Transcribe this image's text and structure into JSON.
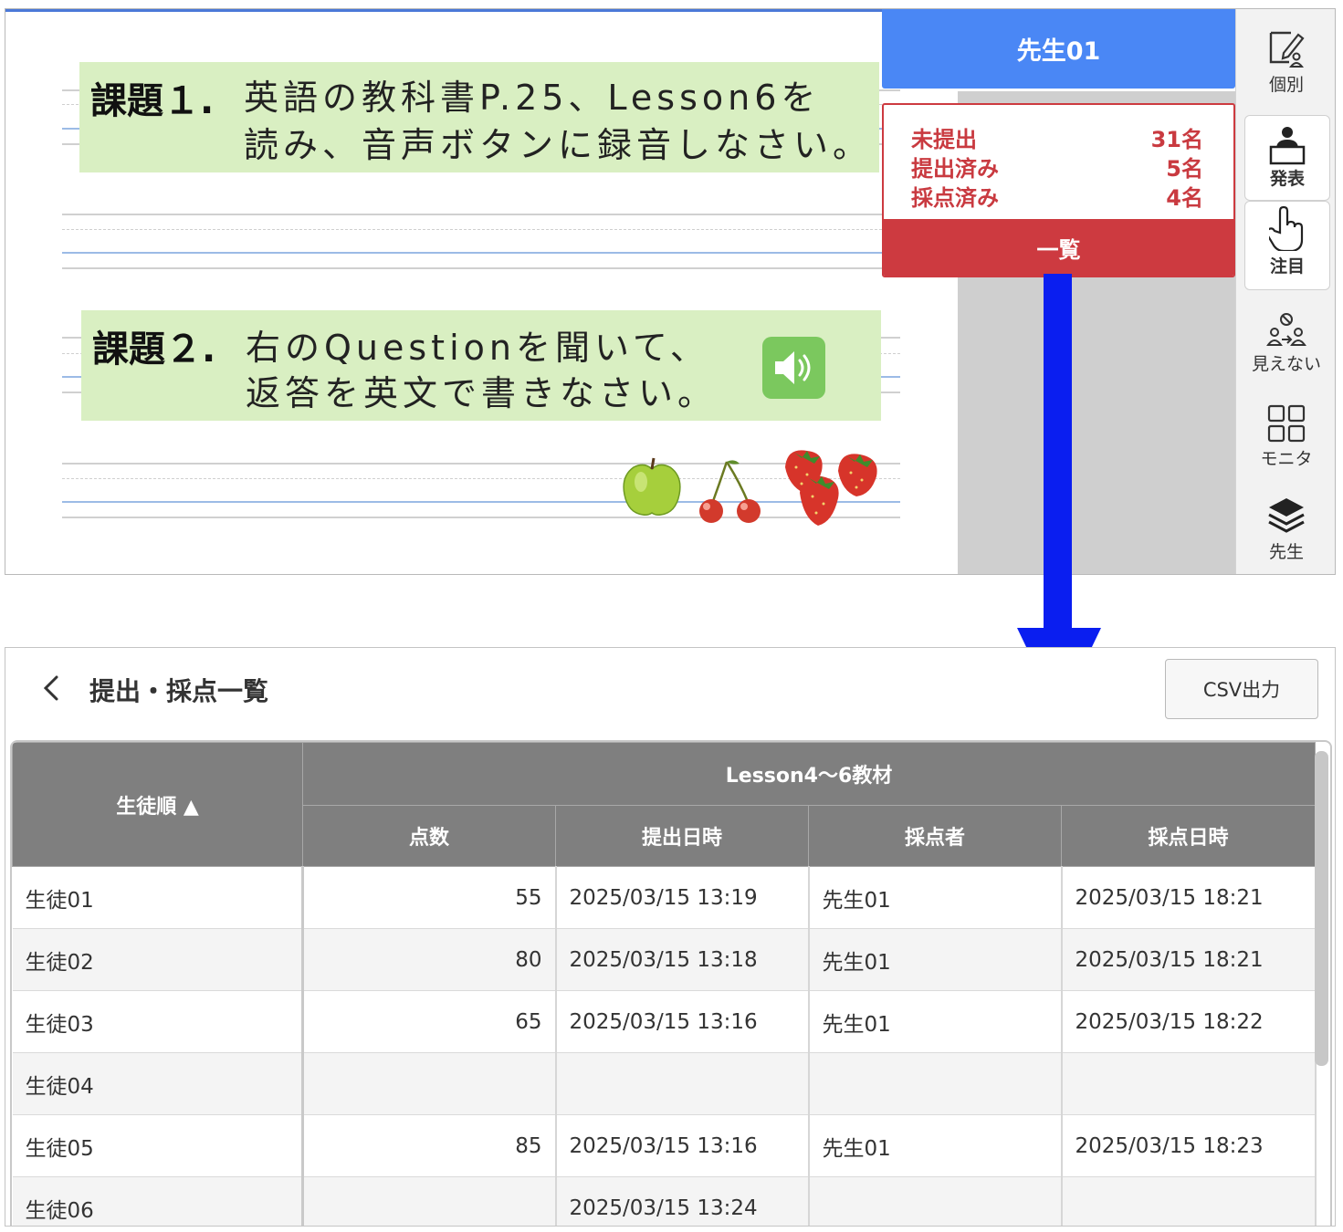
{
  "worksheet": {
    "task1": {
      "label": "課題１.",
      "line1": "英語の教科書P.25、Lesson6を",
      "line2": "読み、音声ボタンに録音しなさい。"
    },
    "task2": {
      "label": "課題２.",
      "line1": "右のQuestionを聞いて、",
      "line2": "返答を英文で書きなさい。"
    },
    "audio_icon": "speaker-icon",
    "fruit_icons": [
      "apple-icon",
      "cherries-icon",
      "strawberries-icon"
    ]
  },
  "teacher": {
    "name": "先生01"
  },
  "status": {
    "rows": [
      {
        "label": "未提出",
        "value": "31名"
      },
      {
        "label": "提出済み",
        "value": "5名"
      },
      {
        "label": "採点済み",
        "value": "4名"
      }
    ],
    "list_button": "一覧"
  },
  "toolbar": {
    "items": [
      {
        "label": "個別",
        "icon": "individual-edit-icon"
      },
      {
        "label": "発表",
        "icon": "presenter-icon"
      },
      {
        "label": "注目",
        "icon": "hand-pointer-icon"
      },
      {
        "label": "見えない",
        "icon": "hide-group-icon"
      },
      {
        "label": "モニタ",
        "icon": "grid-monitor-icon"
      },
      {
        "label": "先生",
        "icon": "layers-icon"
      }
    ]
  },
  "list_page": {
    "title": "提出・採点一覧",
    "csv_button": "CSV出力",
    "table": {
      "sort_column": "生徒順 ▲",
      "group_header": "Lesson4〜6教材",
      "sub_headers": [
        "点数",
        "提出日時",
        "採点者",
        "採点日時"
      ],
      "rows": [
        {
          "student": "生徒01",
          "score": "55",
          "submitted": "2025/03/15 13:19",
          "grader": "先生01",
          "graded": "2025/03/15 18:21"
        },
        {
          "student": "生徒02",
          "score": "80",
          "submitted": "2025/03/15 13:18",
          "grader": "先生01",
          "graded": "2025/03/15 18:21"
        },
        {
          "student": "生徒03",
          "score": "65",
          "submitted": "2025/03/15 13:16",
          "grader": "先生01",
          "graded": "2025/03/15 18:22"
        },
        {
          "student": "生徒04",
          "score": "",
          "submitted": "",
          "grader": "",
          "graded": ""
        },
        {
          "student": "生徒05",
          "score": "85",
          "submitted": "2025/03/15 13:16",
          "grader": "先生01",
          "graded": "2025/03/15 18:23"
        },
        {
          "student": "生徒06",
          "score": "",
          "submitted": "2025/03/15 13:24",
          "grader": "",
          "graded": ""
        }
      ]
    }
  },
  "colors": {
    "teacher_blue": "#4a87f5",
    "status_red": "#cd3a40",
    "arrow_blue": "#0a1ef0",
    "task_green": "#d9efc2"
  }
}
